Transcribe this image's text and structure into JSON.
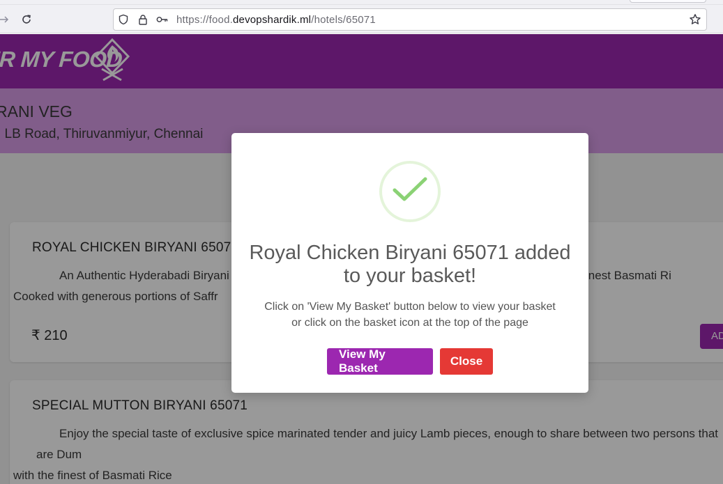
{
  "browser": {
    "url_prefix": "https://food.",
    "url_host": "devopshardik.ml",
    "url_path": "/hotels/65071",
    "forward_icon": "arrow-right-icon",
    "reload_icon": "reload-icon"
  },
  "site": {
    "logo_text": "ER MY FOOD",
    "hotel_name": "RANI VEG",
    "hotel_address": ", LB Road, Thiruvanmiyur, Chennai",
    "brand_color": "#9b27af"
  },
  "dishes": [
    {
      "name": "ROYAL CHICKEN BIRYANI 65071",
      "description": "An Authentic Hyderabadi Biryani w",
      "description_tail": "d with the finest Basmati Ri",
      "description_line2": "Cooked with generous portions of Saffr",
      "price": "₹ 210",
      "add_label": "AD"
    },
    {
      "name": "SPECIAL MUTTON BIRYANI 65071",
      "description": "Enjoy the special taste of exclusive spice marinated tender and juicy Lamb pieces, enough to share between two persons that are Dum",
      "description_line2": "with the finest of Basmati Rice"
    }
  ],
  "modal": {
    "title_line1": "Royal Chicken Biryani 65071 added",
    "title_line2": "to your basket!",
    "text_line1": "Click on 'View My Basket' button below to view your basket",
    "text_line2": "or click on the basket icon at the top of the page",
    "view_basket_label": "View My Basket",
    "close_label": "Close",
    "success_color": "#8bd275",
    "view_basket_color": "#9c27b0",
    "close_color": "#e53935"
  }
}
